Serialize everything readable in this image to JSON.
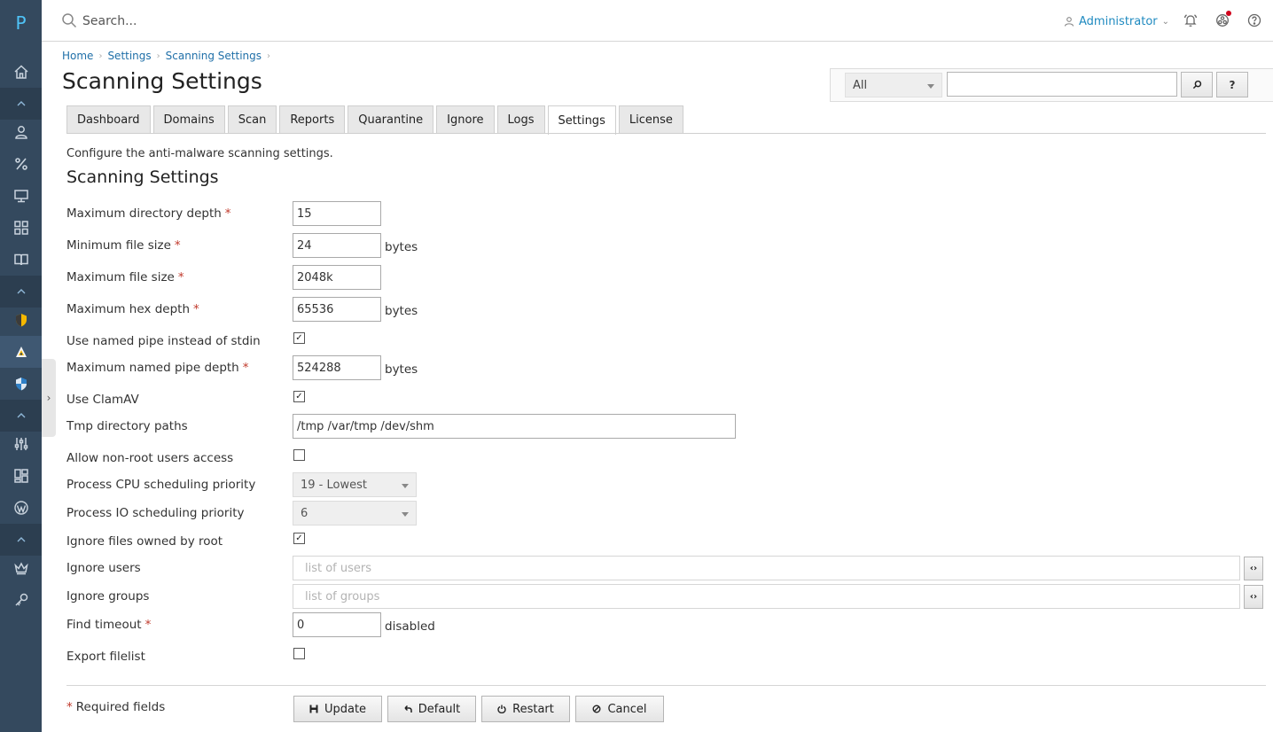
{
  "rail": {
    "logo": "P",
    "items": [
      {
        "icon": "home-icon"
      },
      {
        "icon": "chevron-up-icon"
      },
      {
        "icon": "user-icon"
      },
      {
        "icon": "percent-icon"
      },
      {
        "icon": "monitor-icon"
      },
      {
        "icon": "grid-icon"
      },
      {
        "icon": "book-icon"
      },
      {
        "icon": "chevron-up-icon"
      },
      {
        "icon": "shield-yellow-icon"
      },
      {
        "icon": "antivirus-icon"
      },
      {
        "icon": "shield-blue-icon"
      },
      {
        "icon": "chevron-up-icon"
      },
      {
        "icon": "sliders-icon"
      },
      {
        "icon": "modules-icon"
      },
      {
        "icon": "wordpress-icon"
      },
      {
        "icon": "chevron-up-icon"
      },
      {
        "icon": "crown-icon"
      },
      {
        "icon": "key-icon"
      }
    ],
    "toggle": "›"
  },
  "topbar": {
    "search_placeholder": "Search...",
    "user": "Administrator"
  },
  "breadcrumb": [
    "Home",
    "Settings",
    "Scanning Settings"
  ],
  "page_title": "Scanning Settings",
  "filter": {
    "select_value": "All",
    "search_btn": "⌕",
    "help_btn": "?"
  },
  "tabs": [
    "Dashboard",
    "Domains",
    "Scan",
    "Reports",
    "Quarantine",
    "Ignore",
    "Logs",
    "Settings",
    "License"
  ],
  "active_tab": "Settings",
  "description": "Configure the anti-malware scanning settings.",
  "section_title": "Scanning Settings",
  "form": {
    "max_dir_depth": {
      "label": "Maximum directory depth",
      "value": "15"
    },
    "min_file_size": {
      "label": "Minimum file size",
      "value": "24",
      "unit": "bytes"
    },
    "max_file_size": {
      "label": "Maximum file size",
      "value": "2048k"
    },
    "max_hex_depth": {
      "label": "Maximum hex depth",
      "value": "65536",
      "unit": "bytes"
    },
    "named_pipe": {
      "label": "Use named pipe instead of stdin",
      "checked": true
    },
    "max_pipe_depth": {
      "label": "Maximum named pipe depth",
      "value": "524288",
      "unit": "bytes"
    },
    "clamav": {
      "label": "Use ClamAV",
      "checked": true
    },
    "tmp_paths": {
      "label": "Tmp directory paths",
      "value": "/tmp /var/tmp /dev/shm"
    },
    "nonroot": {
      "label": "Allow non-root users access",
      "checked": false
    },
    "cpu_prio": {
      "label": "Process CPU scheduling priority",
      "value": "19 - Lowest"
    },
    "io_prio": {
      "label": "Process IO scheduling priority",
      "value": "6"
    },
    "ignore_root": {
      "label": "Ignore files owned by root",
      "checked": true
    },
    "ignore_users": {
      "label": "Ignore users",
      "placeholder": "list of users"
    },
    "ignore_groups": {
      "label": "Ignore groups",
      "placeholder": "list of groups"
    },
    "find_timeout": {
      "label": "Find timeout",
      "value": "0",
      "unit": "disabled"
    },
    "export_filelist": {
      "label": "Export filelist",
      "checked": false
    }
  },
  "required_note": "Required fields",
  "required_mark": "*",
  "buttons": {
    "update": "Update",
    "default": "Default",
    "restart": "Restart",
    "cancel": "Cancel"
  },
  "colors": {
    "rail": "#34495e",
    "link": "#1f6fa8",
    "required": "#c0392b",
    "notification": "#d0021b"
  }
}
